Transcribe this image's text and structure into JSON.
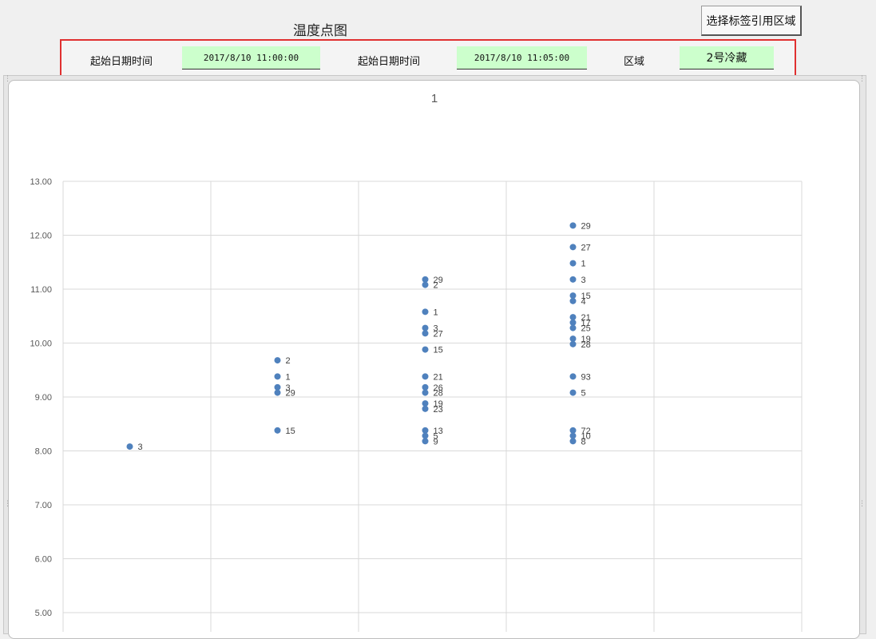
{
  "page": {
    "title": "温度点图"
  },
  "toolbar": {
    "select_button_label": "选择标签引用区域"
  },
  "filters": {
    "start_label": "起始日期时间",
    "start_value": "2017/8/10 11:00:00",
    "end_label": "起始日期时间",
    "end_value": "2017/8/10 11:05:00",
    "zone_label": "区域",
    "zone_value": "2号冷藏"
  },
  "chart_data": {
    "type": "scatter",
    "title": "1",
    "xlabel": "",
    "ylabel": "",
    "ylim": [
      5,
      13
    ],
    "y_ticks": [
      "5.00",
      "6.00",
      "7.00",
      "8.00",
      "9.00",
      "10.00",
      "11.00",
      "12.00",
      "13.00"
    ],
    "x_groups": 5,
    "grid": true,
    "marker_color": "#4f81bd",
    "series": [
      {
        "x": 1,
        "points": [
          {
            "y": 8.08,
            "label": "3"
          }
        ]
      },
      {
        "x": 2,
        "points": [
          {
            "y": 9.68,
            "label": "2"
          },
          {
            "y": 9.38,
            "label": "1"
          },
          {
            "y": 9.18,
            "label": "3"
          },
          {
            "y": 9.08,
            "label": "29"
          },
          {
            "y": 8.38,
            "label": "15"
          }
        ]
      },
      {
        "x": 3,
        "points": [
          {
            "y": 11.18,
            "label": "29"
          },
          {
            "y": 11.08,
            "label": "2"
          },
          {
            "y": 10.58,
            "label": "1"
          },
          {
            "y": 10.28,
            "label": "3"
          },
          {
            "y": 10.18,
            "label": "27"
          },
          {
            "y": 9.88,
            "label": "15"
          },
          {
            "y": 9.38,
            "label": "21"
          },
          {
            "y": 9.18,
            "label": "26"
          },
          {
            "y": 9.08,
            "label": "28"
          },
          {
            "y": 8.88,
            "label": "19"
          },
          {
            "y": 8.78,
            "label": "23"
          },
          {
            "y": 8.38,
            "label": "13"
          },
          {
            "y": 8.28,
            "label": "5"
          },
          {
            "y": 8.18,
            "label": "9"
          }
        ]
      },
      {
        "x": 4,
        "points": [
          {
            "y": 12.18,
            "label": "29"
          },
          {
            "y": 11.78,
            "label": "27"
          },
          {
            "y": 11.48,
            "label": "1"
          },
          {
            "y": 11.18,
            "label": "3"
          },
          {
            "y": 10.88,
            "label": "15"
          },
          {
            "y": 10.78,
            "label": "4"
          },
          {
            "y": 10.48,
            "label": "21"
          },
          {
            "y": 10.38,
            "label": "17"
          },
          {
            "y": 10.28,
            "label": "25"
          },
          {
            "y": 10.08,
            "label": "19"
          },
          {
            "y": 9.98,
            "label": "28"
          },
          {
            "y": 9.38,
            "label": "93"
          },
          {
            "y": 9.08,
            "label": "5"
          },
          {
            "y": 8.38,
            "label": "72"
          },
          {
            "y": 8.28,
            "label": "10"
          },
          {
            "y": 8.18,
            "label": "8"
          }
        ]
      }
    ]
  }
}
